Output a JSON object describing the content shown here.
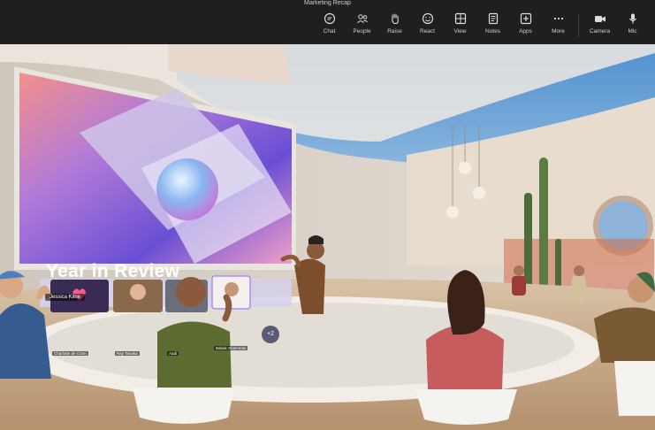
{
  "window": {
    "title": "Marketing Recap"
  },
  "toolbar": {
    "items": [
      {
        "label": "Chat",
        "icon": "chat-icon"
      },
      {
        "label": "People",
        "icon": "people-icon"
      },
      {
        "label": "Raise",
        "icon": "raise-hand-icon"
      },
      {
        "label": "React",
        "icon": "react-icon"
      },
      {
        "label": "View",
        "icon": "view-icon"
      },
      {
        "label": "Notes",
        "icon": "notes-icon"
      },
      {
        "label": "Apps",
        "icon": "apps-icon"
      },
      {
        "label": "More",
        "icon": "more-icon"
      },
      {
        "label": "Camera",
        "icon": "camera-icon"
      },
      {
        "label": "Mic",
        "icon": "mic-icon"
      }
    ]
  },
  "presentation": {
    "title": "Year in Review",
    "presenter": "Jessica Kline"
  },
  "participants": {
    "tiles": [
      {
        "name": "Charlotte de Crum"
      },
      {
        "name": "Ray Tanaka"
      },
      {
        "name": "Aadi"
      },
      {
        "name": "Babak Shammas"
      }
    ],
    "more_count": "+2"
  },
  "colors": {
    "toolbar_bg": "#1f1f1f",
    "sky": "#6aa4d4",
    "wall": "#d9d2c8"
  }
}
